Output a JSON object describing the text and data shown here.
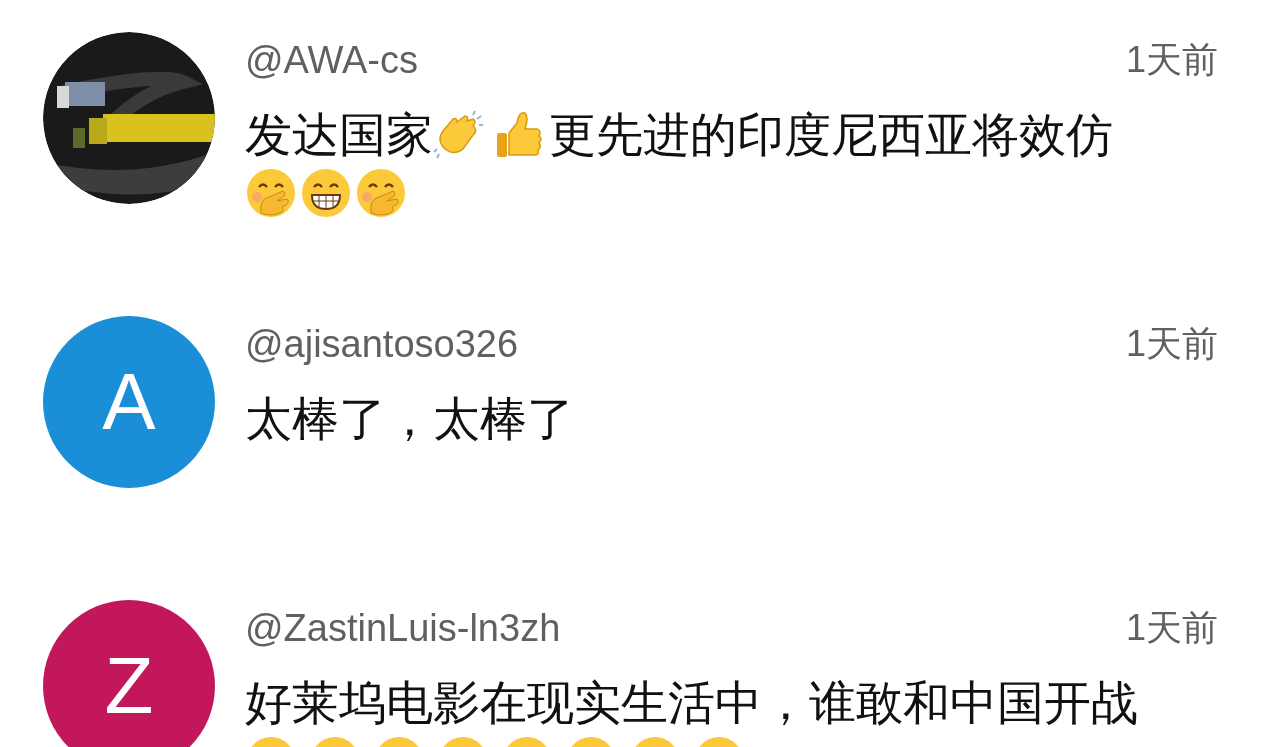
{
  "comments": [
    {
      "avatar": {
        "kind": "picture"
      },
      "username": "@AWA-cs",
      "time": "1天前",
      "lines": [
        [
          {
            "kind": "text",
            "text": "发达国家"
          },
          {
            "kind": "clap"
          },
          {
            "kind": "thumbs_up"
          },
          {
            "kind": "text",
            "text": "更先进的印度尼西亚将效仿"
          }
        ],
        [
          {
            "kind": "hand_over_mouth"
          },
          {
            "kind": "grin"
          },
          {
            "kind": "hand_over_mouth"
          }
        ]
      ]
    },
    {
      "avatar": {
        "kind": "letter",
        "letter": "A",
        "color": "#1a8fd8"
      },
      "username": "@ajisantoso326",
      "time": "1天前",
      "lines": [
        [
          {
            "kind": "text",
            "text": "太棒了，太棒了"
          }
        ]
      ]
    },
    {
      "avatar": {
        "kind": "letter",
        "letter": "Z",
        "color": "#c2185b"
      },
      "username": "@ZastinLuis-ln3zh",
      "time": "1天前",
      "lines": [
        [
          {
            "kind": "text",
            "text": "好莱坞电影在现实生活中，谁敢和中国开战"
          }
        ],
        [
          {
            "kind": "face"
          },
          {
            "kind": "face"
          },
          {
            "kind": "face"
          },
          {
            "kind": "face"
          },
          {
            "kind": "face"
          },
          {
            "kind": "face"
          },
          {
            "kind": "face"
          },
          {
            "kind": "face"
          }
        ]
      ]
    }
  ]
}
